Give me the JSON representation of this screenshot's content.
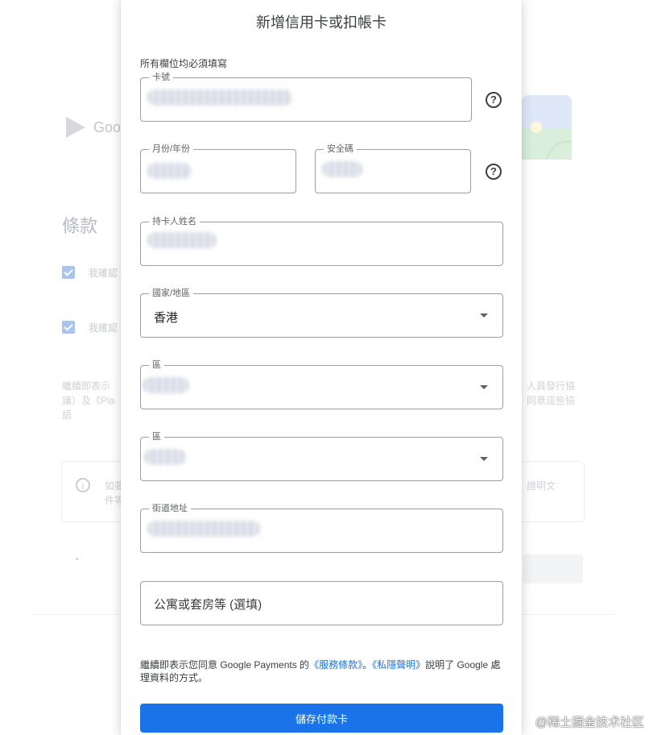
{
  "background": {
    "logo_text": "Goo",
    "section_title": "條款",
    "check1_label": "我確認",
    "check2_label": "我確認",
    "text_left": "繼續即表示\n議）及《Pla\n語",
    "text_right": "人員發行協\n同意這些協",
    "info_left": "如要\n件等",
    "info_right": "證明文"
  },
  "dialog": {
    "title": "新增信用卡或扣帳卡",
    "required_note": "所有欄位均必須填寫",
    "fields": {
      "card_number": {
        "label": "卡號"
      },
      "expiry": {
        "label": "月份/年份"
      },
      "cvc": {
        "label": "安全碼"
      },
      "cardholder": {
        "label": "持卡人姓名"
      },
      "country": {
        "label": "國家/地區",
        "value": "香港"
      },
      "district1": {
        "label": "區"
      },
      "district2": {
        "label": "區"
      },
      "street": {
        "label": "街道地址"
      },
      "apartment": {
        "placeholder": "公寓或套房等 (選填)"
      }
    },
    "help_icon_glyph": "?",
    "legal": {
      "prefix": "繼續即表示您同意 Google Payments 的",
      "terms_link": "《服務條款》",
      "separator": "。",
      "privacy_link": "《私隱聲明》",
      "suffix": "說明了 Google 處理資料的方式。"
    },
    "save_button": "儲存付款卡"
  },
  "watermark": "@稀土掘金技术社区",
  "colors": {
    "accent": "#1a73e8",
    "border": "#9aa0a6"
  }
}
